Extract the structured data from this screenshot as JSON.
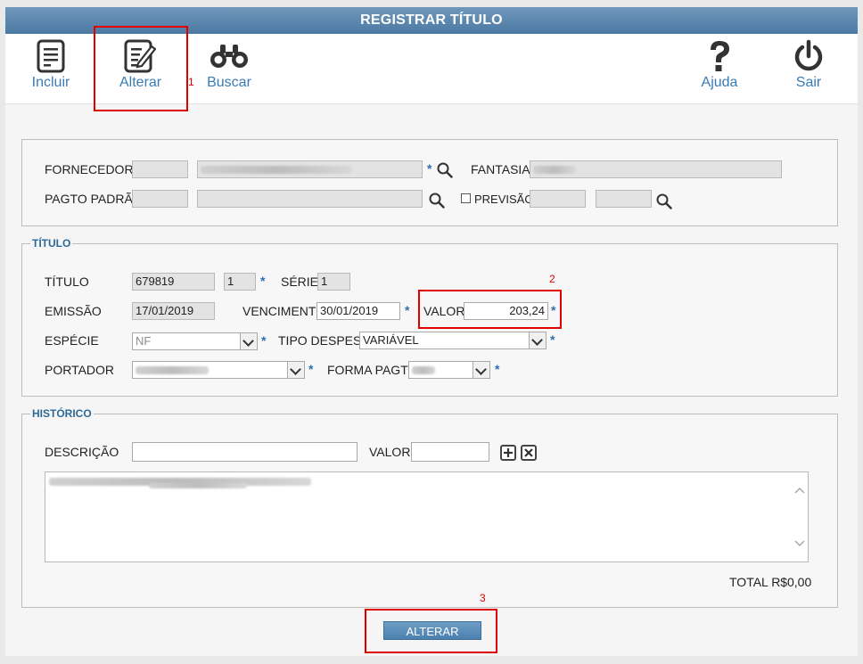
{
  "window": {
    "title": "REGISTRAR TÍTULO"
  },
  "toolbar": {
    "incluir": "Incluir",
    "alterar": "Alterar",
    "buscar": "Buscar",
    "ajuda": "Ajuda",
    "sair": "Sair"
  },
  "annotations": {
    "n1": "1",
    "n2": "2",
    "n3": "3"
  },
  "fornecedor_section": {
    "fornecedor_label": "FORNECEDOR",
    "fantasia_label": "FANTASIA",
    "pagto_padrao_label": "PAGTO PADRÃO",
    "previsao_label": "PREVISÃO"
  },
  "titulo_section": {
    "legend": "TÍTULO",
    "titulo_label": "TÍTULO",
    "titulo_value": "679819",
    "seq_value": "1",
    "serie_label": "SÉRIE",
    "serie_value": "1",
    "emissao_label": "EMISSÃO",
    "emissao_value": "17/01/2019",
    "vencimento_label": "VENCIMENTO",
    "vencimento_value": "30/01/2019",
    "valor_label": "VALOR",
    "valor_value": "203,24",
    "especie_label": "ESPÉCIE",
    "especie_value": "NF",
    "tipo_despesa_label": "TIPO DESPESA",
    "tipo_despesa_value": "VARIÁVEL",
    "portador_label": "PORTADOR",
    "forma_pagto_label": "FORMA PAGTO"
  },
  "historico_section": {
    "legend": "HISTÓRICO",
    "descricao_label": "DESCRIÇÃO",
    "valor_label": "VALOR",
    "total_label": "TOTAL R$",
    "total_value": "0,00"
  },
  "required_mark": "*",
  "submit_label": "ALTERAR",
  "colors": {
    "accent": "#4c7aa3",
    "highlight": "#e00000",
    "link": "#3a7bb5"
  }
}
